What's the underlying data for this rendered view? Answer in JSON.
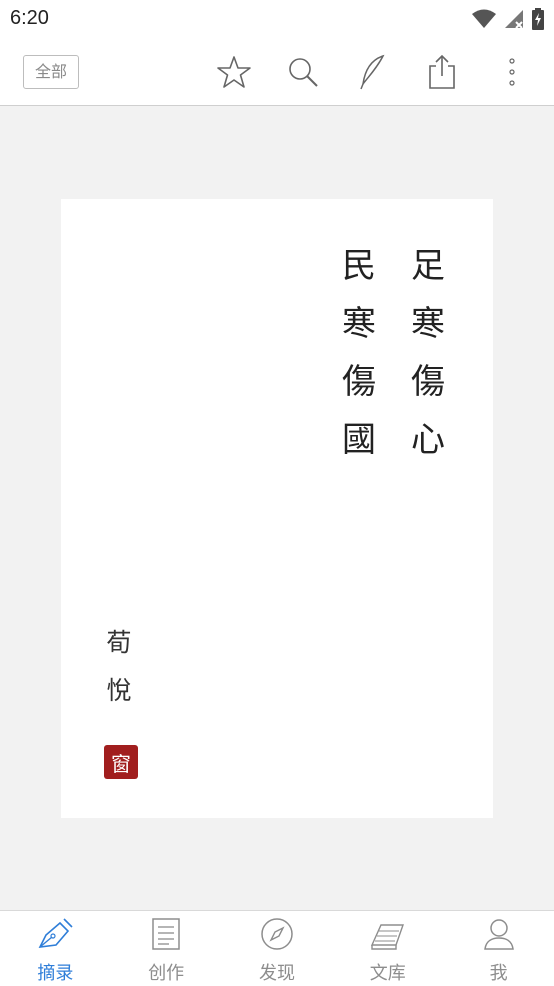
{
  "status_bar": {
    "time": "6:20"
  },
  "toolbar": {
    "filter_label": "全部",
    "icons": [
      "star-icon",
      "search-icon",
      "quill-pen-icon",
      "share-icon",
      "more-vert-icon"
    ]
  },
  "card": {
    "poem_columns": [
      {
        "chars": [
          "足",
          "寒",
          "傷",
          "心"
        ]
      },
      {
        "chars": [
          "民",
          "寒",
          "傷",
          "國"
        ]
      }
    ],
    "author_chars": [
      "荀",
      "悅"
    ],
    "seal_char": "窗"
  },
  "bottom_nav": {
    "active_color": "#2f7ed8",
    "inactive_color": "#8d8d8d",
    "items": [
      {
        "label": "摘录",
        "icon": "fountain-pen-icon",
        "active": true
      },
      {
        "label": "创作",
        "icon": "document-icon",
        "active": false
      },
      {
        "label": "发现",
        "icon": "compass-icon",
        "active": false
      },
      {
        "label": "文库",
        "icon": "books-icon",
        "active": false
      },
      {
        "label": "我",
        "icon": "person-icon",
        "active": false
      }
    ]
  }
}
